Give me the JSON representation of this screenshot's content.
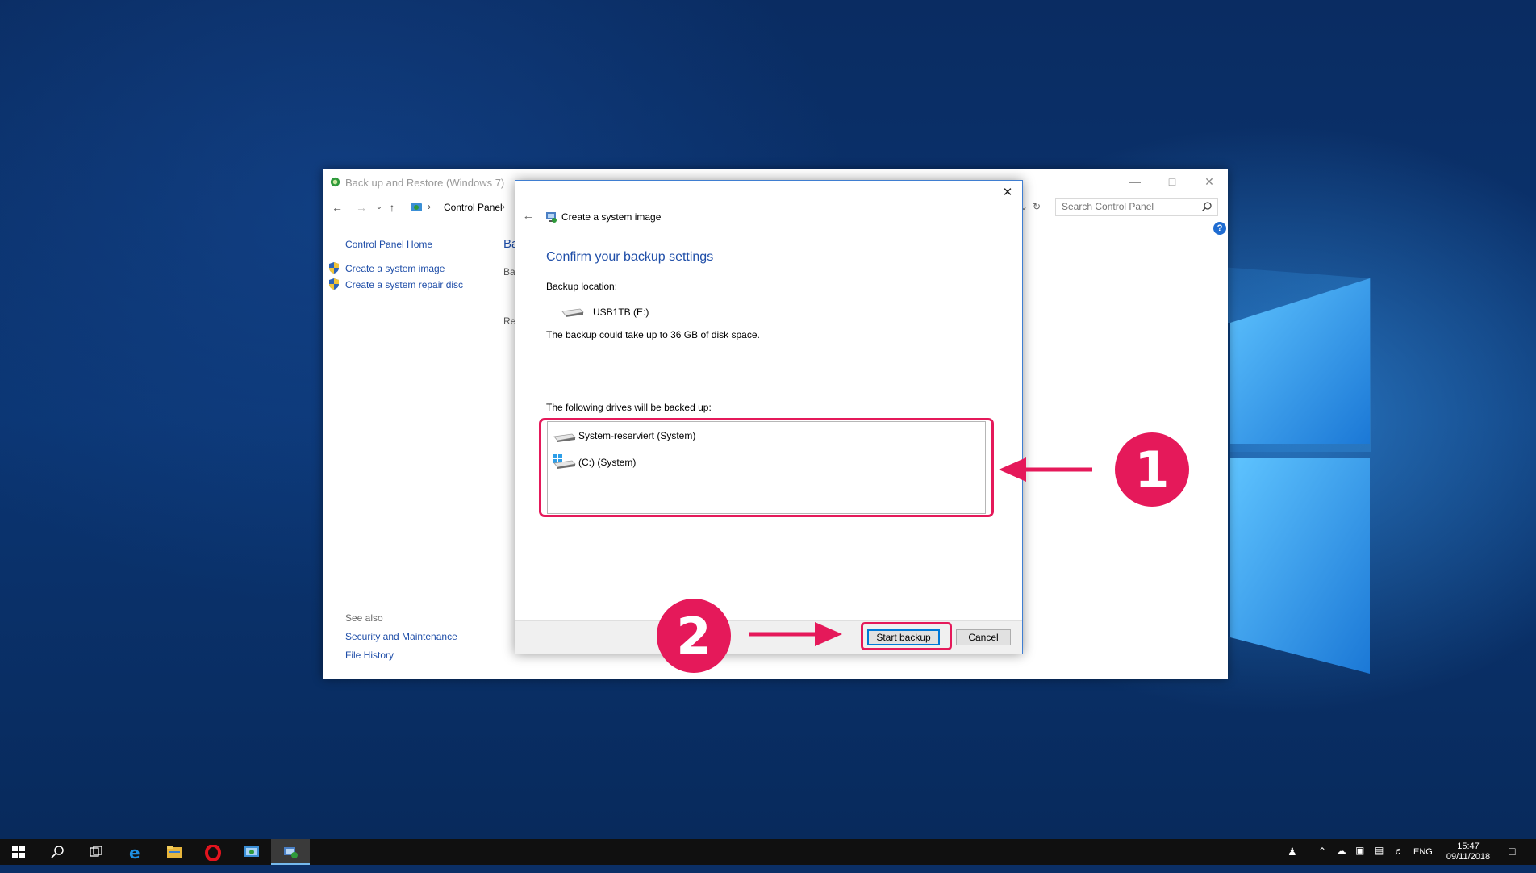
{
  "main_window": {
    "title": "Back up and Restore (Windows 7)",
    "breadcrumb": "Control Panel",
    "search_placeholder": "Search Control Panel",
    "help_glyph": "?",
    "sidebar": {
      "home": "Control Panel Home",
      "items": [
        {
          "label": "Create a system image",
          "icon": "shield-icon"
        },
        {
          "label": "Create a system repair disc",
          "icon": "shield-icon"
        }
      ],
      "see_also_heading": "See also",
      "see_also": [
        "Security and Maintenance",
        "File History"
      ]
    },
    "main_peek": [
      "Ba",
      "Ba",
      "Re"
    ]
  },
  "dialog": {
    "title": "Create a system image",
    "heading": "Confirm your backup settings",
    "backup_location_label": "Backup location:",
    "location_name": "USB1TB (E:)",
    "space_note": "The backup could take up to 36 GB of disk space.",
    "drives_label": "The following drives will be backed up:",
    "drives": [
      {
        "name": "System-reserviert (System)",
        "icon": "hard-drive-icon"
      },
      {
        "name": "(C:) (System)",
        "icon": "windows-drive-icon"
      }
    ],
    "start_button": "Start backup",
    "cancel_button": "Cancel"
  },
  "annotations": {
    "step1": "1",
    "step2": "2",
    "color": "#e5195a"
  },
  "taskbar": {
    "apps": [
      "start-icon",
      "search-icon",
      "task-view-icon",
      "edge-icon",
      "file-explorer-icon",
      "opera-icon",
      "control-panel-icon",
      "backup-app-icon"
    ],
    "language": "ENG",
    "time": "15:47",
    "date": "09/11/2018"
  }
}
